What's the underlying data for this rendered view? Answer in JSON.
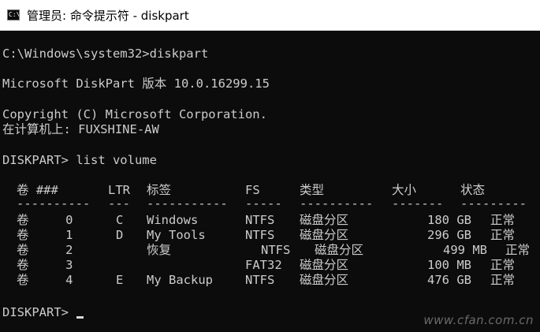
{
  "window": {
    "title": "管理员: 命令提示符 - diskpart",
    "icon_glyph": "C:\\"
  },
  "console": {
    "line_command": "C:\\Windows\\system32>diskpart",
    "line_version": "Microsoft DiskPart 版本 10.0.16299.15",
    "line_copyright": "Copyright (C) Microsoft Corporation.",
    "line_machine": "在计算机上: FUXSHINE-AW",
    "line_list": "DISKPART> list volume",
    "prompt": "DISKPART> "
  },
  "volumes": {
    "headers": [
      "卷 ###",
      "LTR",
      "标签",
      "FS",
      "类型",
      "大小",
      "状态"
    ],
    "separators": [
      "----------",
      "---",
      "-----------",
      "-----",
      "----------",
      "-------",
      "---------"
    ],
    "rows": [
      {
        "vol": "卷     0",
        "ltr": "C",
        "label": "Windows",
        "fs": "NTFS",
        "type": "磁盘分区",
        "size": "180 GB",
        "status": "正常"
      },
      {
        "vol": "卷     1",
        "ltr": "D",
        "label": "My Tools",
        "fs": "NTFS",
        "type": "磁盘分区",
        "size": "296 GB",
        "status": "正常"
      },
      {
        "vol": "卷     2",
        "ltr": "",
        "label": "恢复",
        "fs": "NTFS",
        "type": "磁盘分区",
        "size": "499 MB",
        "status": "正常"
      },
      {
        "vol": "卷     3",
        "ltr": "",
        "label": "",
        "fs": "FAT32",
        "type": "磁盘分区",
        "size": "100 MB",
        "status": "正常"
      },
      {
        "vol": "卷     4",
        "ltr": "E",
        "label": "My Backup",
        "fs": "NTFS",
        "type": "磁盘分区",
        "size": "476 GB",
        "status": "正常"
      }
    ]
  },
  "watermark": "www.cfan.com.cn",
  "colors": {
    "console_bg": "#0c0c0c",
    "console_fg": "#cccccc",
    "titlebar_bg": "#ffffff"
  }
}
